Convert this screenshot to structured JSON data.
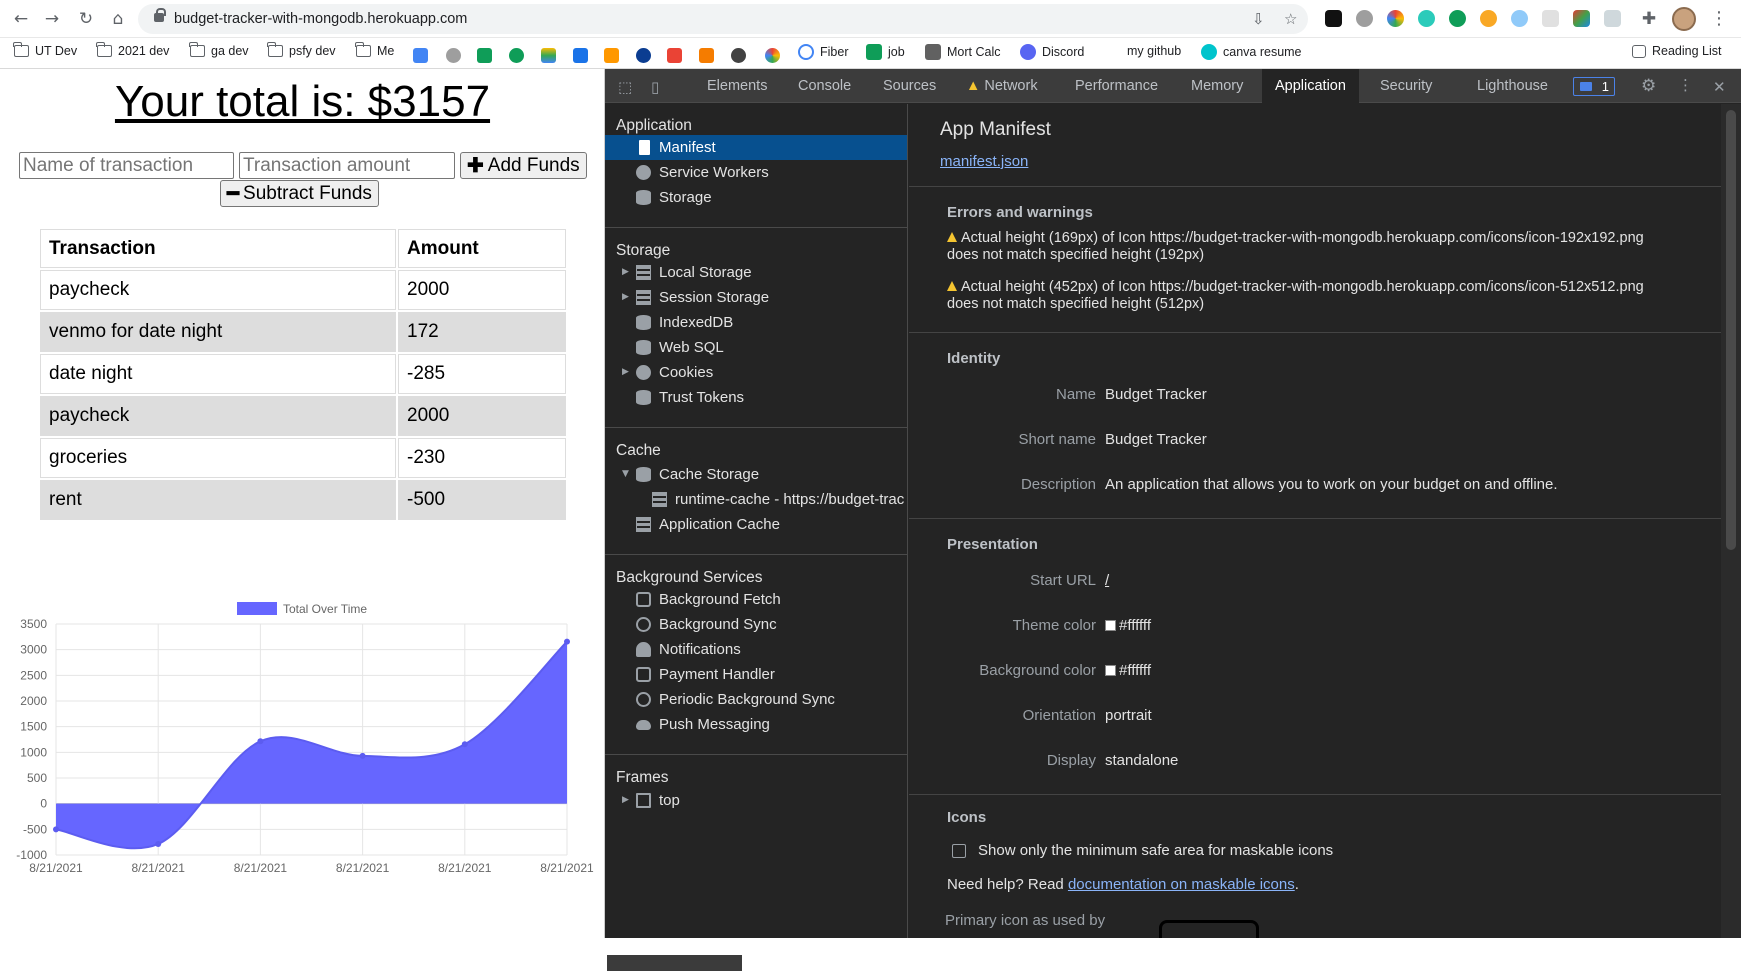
{
  "browser": {
    "url": "budget-tracker-with-mongodb.herokuapp.com",
    "bookmarks": [
      "UT Dev",
      "2021 dev",
      "ga dev",
      "psfy dev",
      "Me",
      "Fiber",
      "job",
      "Mort Calc",
      "Discord",
      "my github",
      "canva resume"
    ],
    "reading_list": "Reading List",
    "extension_badge": "1"
  },
  "app": {
    "total_text": "Your total is: $3157",
    "name_placeholder": "Name of transaction",
    "amount_placeholder": "Transaction amount",
    "add_label": "Add Funds",
    "subtract_label": "Subtract Funds",
    "table": {
      "headers": [
        "Transaction",
        "Amount"
      ],
      "rows": [
        {
          "name": "paycheck",
          "amount": "2000"
        },
        {
          "name": "venmo for date night",
          "amount": "172"
        },
        {
          "name": "date night",
          "amount": "-285"
        },
        {
          "name": "paycheck",
          "amount": "2000"
        },
        {
          "name": "groceries",
          "amount": "-230"
        },
        {
          "name": "rent",
          "amount": "-500"
        }
      ]
    }
  },
  "chart_data": {
    "type": "area",
    "legend": "Total Over Time",
    "x": [
      "8/21/2021",
      "8/21/2021",
      "8/21/2021",
      "8/21/2021",
      "8/21/2021",
      "8/21/2021"
    ],
    "values": [
      -500,
      -785,
      1215,
      930,
      1157,
      3157
    ],
    "ylim": [
      -1000,
      3500
    ],
    "yticks": [
      "3500",
      "3000",
      "2500",
      "2000",
      "1500",
      "1000",
      "500",
      "0",
      "-500",
      "-1000"
    ],
    "color": "#6666ff"
  },
  "devtools": {
    "tabs": [
      "Elements",
      "Console",
      "Sources",
      "Network",
      "Performance",
      "Memory",
      "Application",
      "Security",
      "Lighthouse"
    ],
    "active_tab": "Application",
    "issues_count": "1",
    "sidebar": {
      "application_title": "Application",
      "application_items": [
        "Manifest",
        "Service Workers",
        "Storage"
      ],
      "storage_title": "Storage",
      "storage_items": [
        "Local Storage",
        "Session Storage",
        "IndexedDB",
        "Web SQL",
        "Cookies",
        "Trust Tokens"
      ],
      "cache_title": "Cache",
      "cache_items": [
        "Cache Storage",
        "runtime-cache - https://budget-trac",
        "Application Cache"
      ],
      "bg_title": "Background Services",
      "bg_items": [
        "Background Fetch",
        "Background Sync",
        "Notifications",
        "Payment Handler",
        "Periodic Background Sync",
        "Push Messaging"
      ],
      "frames_title": "Frames",
      "frames_items": [
        "top"
      ]
    },
    "manifest": {
      "title": "App Manifest",
      "link": "manifest.json",
      "errors_title": "Errors and warnings",
      "warning1_a": "Actual height (169px) of Icon https://budget-tracker-with-mongodb.herokuapp.com/icons/icon-192x192.png",
      "warning1_b": "does not match specified height (192px)",
      "warning2_a": "Actual height (452px) of Icon https://budget-tracker-with-mongodb.herokuapp.com/icons/icon-512x512.png",
      "warning2_b": "does not match specified height (512px)",
      "identity_title": "Identity",
      "identity": [
        {
          "k": "Name",
          "v": "Budget Tracker"
        },
        {
          "k": "Short name",
          "v": "Budget Tracker"
        },
        {
          "k": "Description",
          "v": "An application that allows you to work on your budget on and offline."
        }
      ],
      "presentation_title": "Presentation",
      "start_url_label": "Start URL",
      "start_url": "/",
      "theme_color_label": "Theme color",
      "theme_color": "#ffffff",
      "bg_color_label": "Background color",
      "bg_color": "#ffffff",
      "orientation_label": "Orientation",
      "orientation": "portrait",
      "display_label": "Display",
      "display": "standalone",
      "icons_title": "Icons",
      "maskable_checkbox": "Show only the minimum safe area for maskable icons",
      "help_prefix": "Need help? Read ",
      "help_link": "documentation on maskable icons",
      "help_suffix": ".",
      "primary_icon_label": "Primary icon as used by"
    }
  }
}
